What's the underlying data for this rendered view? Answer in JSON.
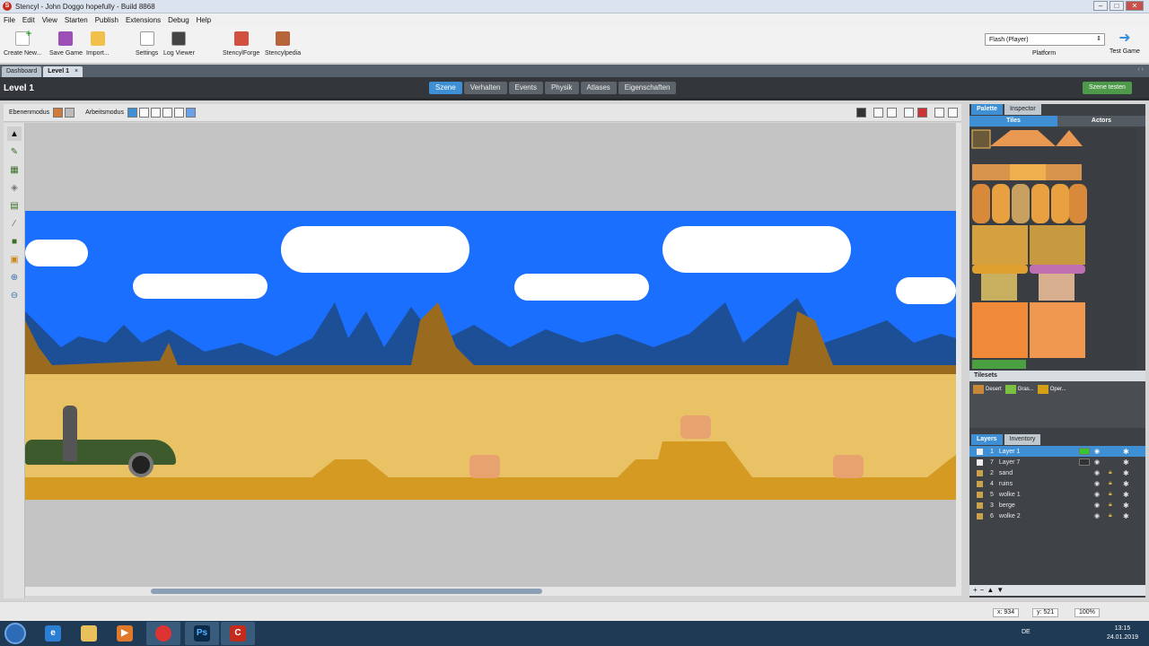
{
  "window": {
    "title": "Stencyl - John Doggo hopefully - Build 8868",
    "app_icon": "stencyl-icon"
  },
  "menu": [
    "File",
    "Edit",
    "View",
    "Starten",
    "Publish",
    "Extensions",
    "Debug",
    "Help"
  ],
  "toolbar": {
    "create_new": "Create New...",
    "save_game": "Save Game",
    "import": "Import...",
    "settings": "Settings",
    "log_viewer": "Log Viewer",
    "stencylforge": "StencylForge",
    "stencylpedia": "Stencylpedia",
    "platform_value": "Flash (Player)",
    "platform_label": "Platform",
    "test_game": "Test Game"
  },
  "doc_tabs": [
    {
      "label": "Dashboard",
      "active": false
    },
    {
      "label": "Level 1",
      "active": true,
      "closable": true
    }
  ],
  "scene": {
    "title": "Level 1",
    "tabs": [
      "Szene",
      "Verhalten",
      "Events",
      "Physik",
      "Atlases",
      "Eigenschaften"
    ],
    "active_tab": "Szene",
    "test_button": "Szene testen"
  },
  "modebar": {
    "layer_mode_label": "Ebenenmodus",
    "work_mode_label": "Arbeitsmodus"
  },
  "palette": {
    "tabs": [
      "Palette",
      "Inspector"
    ],
    "active_tab": "Palette",
    "subtabs": [
      "Tiles",
      "Actors"
    ],
    "active_subtab": "Tiles",
    "tilesets_header": "Tilesets",
    "tilesets": [
      {
        "name": "Desert",
        "color": "#c8883a"
      },
      {
        "name": "Gras...",
        "color": "#7bc043"
      },
      {
        "name": "Oper...",
        "color": "#d4a017"
      }
    ]
  },
  "layers": {
    "tabs": [
      "Layers",
      "Inventory"
    ],
    "active_tab": "Layers",
    "items": [
      {
        "id": "1",
        "name": "Layer 1",
        "active": true
      },
      {
        "id": "7",
        "name": "Layer 7",
        "active": false
      },
      {
        "id": "2",
        "name": "sand",
        "active": false
      },
      {
        "id": "4",
        "name": "ruins",
        "active": false
      },
      {
        "id": "5",
        "name": "wolke 1",
        "active": false
      },
      {
        "id": "3",
        "name": "berge",
        "active": false
      },
      {
        "id": "6",
        "name": "wolke 2",
        "active": false
      }
    ],
    "controls": [
      "+",
      "−",
      "▲",
      "▼"
    ]
  },
  "status": {
    "x_label": "x:",
    "x_value": "934",
    "y_label": "y:",
    "y_value": "521",
    "zoom": "100%"
  },
  "taskbar": {
    "lang": "DE",
    "time": "13:15",
    "date": "24.01.2019",
    "apps": [
      "ie",
      "explorer",
      "media",
      "chrome",
      "photoshop",
      "stencyl"
    ]
  },
  "colors": {
    "sky": "#1a6fff",
    "sand": "#e8c264",
    "accent": "#3f8fd5",
    "green_button": "#4f9a4a"
  }
}
